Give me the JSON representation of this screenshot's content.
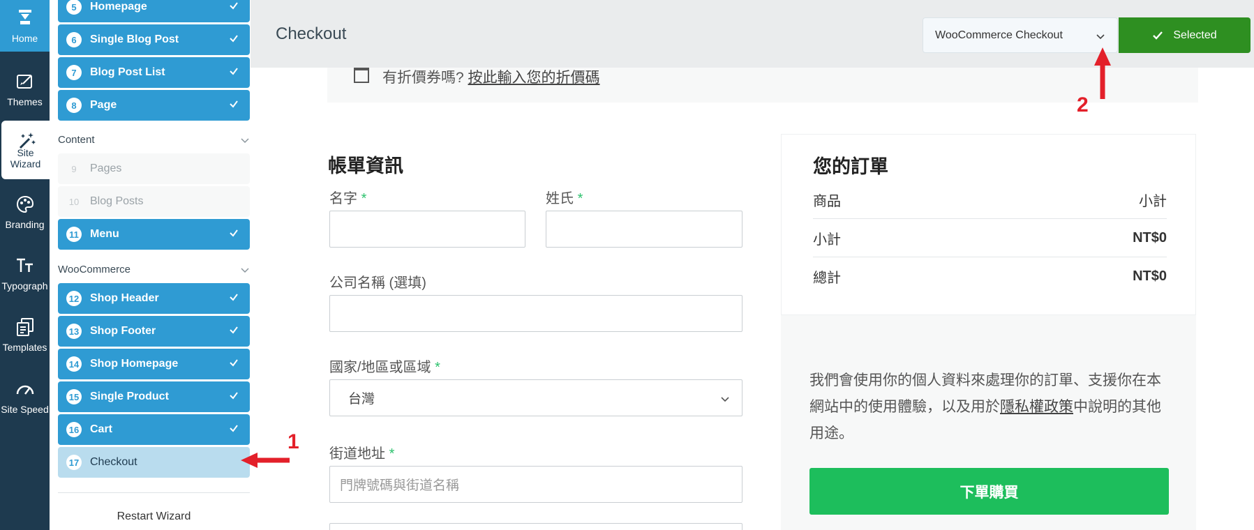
{
  "rail": {
    "items": [
      {
        "label": "Home",
        "icon": "home-icon"
      },
      {
        "label": "Themes",
        "icon": "themes-icon"
      },
      {
        "label_line1": "Site",
        "label_line2": "Wizard",
        "icon": "site-wizard-icon"
      },
      {
        "label": "Branding",
        "icon": "palette-icon"
      },
      {
        "label": "Typograph",
        "icon": "typography-icon"
      },
      {
        "label": "Templates",
        "icon": "templates-icon"
      },
      {
        "label": "Site Speed",
        "icon": "speedometer-icon"
      }
    ]
  },
  "steps": {
    "items": [
      {
        "num": "5",
        "label": "Homepage",
        "state": "done"
      },
      {
        "num": "6",
        "label": "Single Blog Post",
        "state": "done"
      },
      {
        "num": "7",
        "label": "Blog Post List",
        "state": "done"
      },
      {
        "num": "8",
        "label": "Page",
        "state": "done"
      },
      {
        "num": "9",
        "label": "Pages",
        "state": "pending"
      },
      {
        "num": "10",
        "label": "Blog Posts",
        "state": "pending"
      },
      {
        "num": "11",
        "label": "Menu",
        "state": "done"
      },
      {
        "num": "12",
        "label": "Shop Header",
        "state": "done"
      },
      {
        "num": "13",
        "label": "Shop Footer",
        "state": "done"
      },
      {
        "num": "14",
        "label": "Shop Homepage",
        "state": "done"
      },
      {
        "num": "15",
        "label": "Single Product",
        "state": "done"
      },
      {
        "num": "16",
        "label": "Cart",
        "state": "done"
      },
      {
        "num": "17",
        "label": "Checkout",
        "state": "current"
      }
    ],
    "section_content": "Content",
    "section_woocommerce": "WooCommerce",
    "restart_label": "Restart Wizard"
  },
  "topbar": {
    "title": "Checkout",
    "template_select_value": "WooCommerce Checkout",
    "selected_label": "Selected"
  },
  "checkout": {
    "coupon_prompt": "有折價券嗎?",
    "coupon_link": "按此輸入您的折價碼",
    "billing_title": "帳單資訊",
    "first_name_label": "名字",
    "last_name_label": "姓氏",
    "company_label": "公司名稱 (選填)",
    "country_label": "國家/地區或區域",
    "country_value": "台灣",
    "street_label": "街道地址",
    "street_placeholder": "門牌號碼與街道名稱",
    "required_mark": "*"
  },
  "order": {
    "title": "您的訂單",
    "header_product": "商品",
    "header_subtotal": "小計",
    "subtotal_label": "小計",
    "subtotal_value": "NT$0",
    "total_label": "總計",
    "total_value": "NT$0",
    "privacy_before": "我們會使用你的個人資料來處理你的訂單、支援你在本網站中的使用體驗，以及用於",
    "privacy_link": "隱私權政策",
    "privacy_after": "中說明的其他用途。",
    "place_order": "下單購買"
  },
  "annotations": {
    "one": "1",
    "two": "2"
  },
  "colors": {
    "rail_bg": "#1e3a4f",
    "accent_blue": "#2f9bd3",
    "selected_green": "#2e8f21",
    "order_button_green": "#1dbe5c",
    "annotation_red": "#e3202a"
  }
}
